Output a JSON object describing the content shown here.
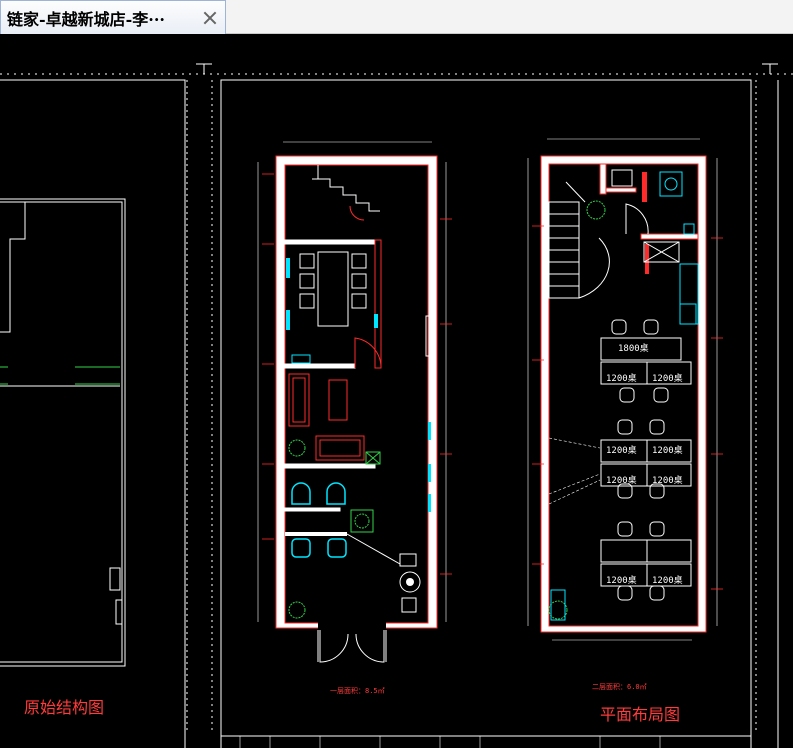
{
  "tab": {
    "title": "链家-卓越新城店-李···"
  },
  "drawing": {
    "label_left": "原始结构图",
    "label_right": "平面布局图",
    "area_left": "一层面积：8.5㎡",
    "area_right": "二层面积：6.0㎡",
    "desks": [
      "1800桌",
      "1200桌",
      "1200桌",
      "1200桌",
      "1200桌",
      "1200桌",
      "1200桌",
      "1200桌",
      "1200桌"
    ]
  },
  "colors": {
    "wall": "#ffffff",
    "wall_outline": "#ff2a2a",
    "furniture": "#ffffff",
    "accent_cyan": "#00e5ff",
    "accent_green": "#2fd34a",
    "label_red": "#ff3b3b"
  }
}
